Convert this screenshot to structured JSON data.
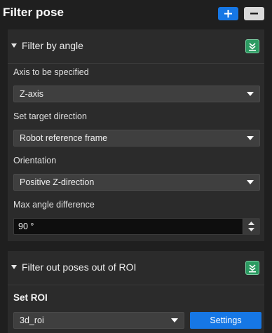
{
  "header": {
    "title": "Filter pose"
  },
  "filter_by_angle": {
    "title": "Filter by angle",
    "axis_label": "Axis to be specified",
    "axis_value": "Z-axis",
    "target_label": "Set target direction",
    "target_value": "Robot reference frame",
    "orientation_label": "Orientation",
    "orientation_value": "Positive Z-direction",
    "max_angle_label": "Max angle difference",
    "max_angle_value": "90 °"
  },
  "filter_roi": {
    "title": "Filter out poses out of ROI",
    "set_roi_title": "Set ROI",
    "roi_value": "3d_roi",
    "settings_label": "Settings"
  },
  "colors": {
    "accent": "#1677e5",
    "collapse_green": "#2c9b62",
    "panel": "#2b2b2b",
    "background": "#1f1f1f"
  },
  "icons": [
    "plus-icon",
    "minus-icon",
    "triangle-down-icon",
    "collapse-icon",
    "caret-down-icon",
    "spin-up-icon",
    "spin-down-icon"
  ]
}
